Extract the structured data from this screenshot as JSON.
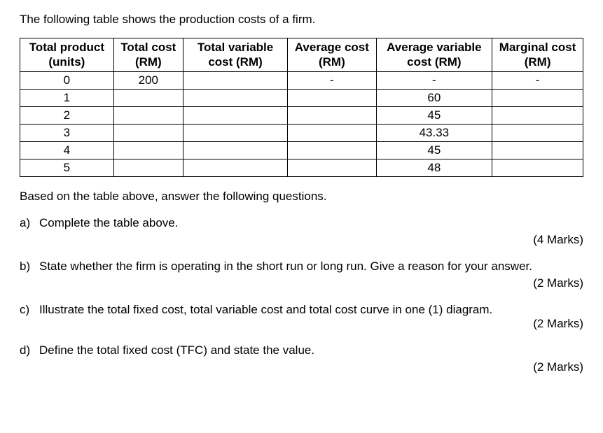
{
  "intro": "The following table shows the production costs of a firm.",
  "table": {
    "headers": {
      "c0": "Total product (units)",
      "c1": "Total cost (RM)",
      "c2": "Total variable cost (RM)",
      "c3": "Average cost (RM)",
      "c4": "Average variable cost (RM)",
      "c5": "Marginal cost (RM)"
    },
    "rows": [
      {
        "c0": "0",
        "c1": "200",
        "c2": "",
        "c3": "-",
        "c4": "-",
        "c5": "-"
      },
      {
        "c0": "1",
        "c1": "",
        "c2": "",
        "c3": "",
        "c4": "60",
        "c5": ""
      },
      {
        "c0": "2",
        "c1": "",
        "c2": "",
        "c3": "",
        "c4": "45",
        "c5": ""
      },
      {
        "c0": "3",
        "c1": "",
        "c2": "",
        "c3": "",
        "c4": "43.33",
        "c5": ""
      },
      {
        "c0": "4",
        "c1": "",
        "c2": "",
        "c3": "",
        "c4": "45",
        "c5": ""
      },
      {
        "c0": "5",
        "c1": "",
        "c2": "",
        "c3": "",
        "c4": "48",
        "c5": ""
      }
    ]
  },
  "instruction": "Based on the table above, answer the following questions.",
  "questions": {
    "a": {
      "label": "a)",
      "text": "Complete the table above.",
      "marks": "(4 Marks)"
    },
    "b": {
      "label": "b)",
      "text": "State whether the firm is operating in the short run or long run. Give a reason for your answer.",
      "marks": "(2 Marks)"
    },
    "c": {
      "label": "c)",
      "text": "Illustrate the total fixed cost, total variable cost and total cost curve in one (1) diagram.",
      "marks": "(2 Marks)"
    },
    "d": {
      "label": "d)",
      "text": "Define the total fixed cost (TFC) and state the value.",
      "marks": "(2 Marks)"
    }
  }
}
